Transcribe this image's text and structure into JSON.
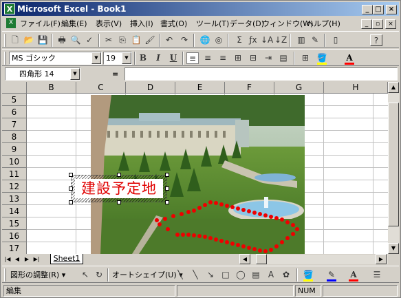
{
  "window": {
    "title": "Microsoft Excel - Book1",
    "app_icon": "X",
    "controls": [
      "_",
      "□",
      "×"
    ]
  },
  "menu": {
    "items": [
      "ファイル(F)",
      "編集(E)",
      "表示(V)",
      "挿入(I)",
      "書式(O)",
      "ツール(T)",
      "データ(D)",
      "ウィンドウ(W)",
      "ヘルプ(H)"
    ],
    "mdi_controls": [
      "_",
      "▫",
      "×"
    ]
  },
  "format_toolbar": {
    "font_name": "MS ゴシック",
    "font_size": "19",
    "bold": "B",
    "italic": "I",
    "underline": "U",
    "font_color_glyph": "A"
  },
  "formula_bar": {
    "name_box": "四角形 14",
    "equals": "=",
    "formula": ""
  },
  "sheet": {
    "columns": [
      "B",
      "C",
      "D",
      "E",
      "F",
      "G",
      "H"
    ],
    "rows": [
      "5",
      "6",
      "7",
      "8",
      "9",
      "10",
      "11",
      "12",
      "13",
      "14",
      "15",
      "16",
      "17"
    ],
    "selected_shape_text": "建設予定地"
  },
  "tabs": {
    "sheet_tab": "Sheet1",
    "nav": [
      "|◀",
      "◀",
      "▶",
      "▶|"
    ]
  },
  "drawing_toolbar": {
    "adjust_shapes": "図形の調整(R)",
    "autoshapes": "オートシェイプ(U)"
  },
  "status": {
    "mode": "編集",
    "num": "NUM"
  },
  "colors": {
    "title_gradient_start": "#0a246a",
    "title_gradient_end": "#a6caf0",
    "label_text": "#e00000",
    "route_dots": "#ee0000"
  }
}
